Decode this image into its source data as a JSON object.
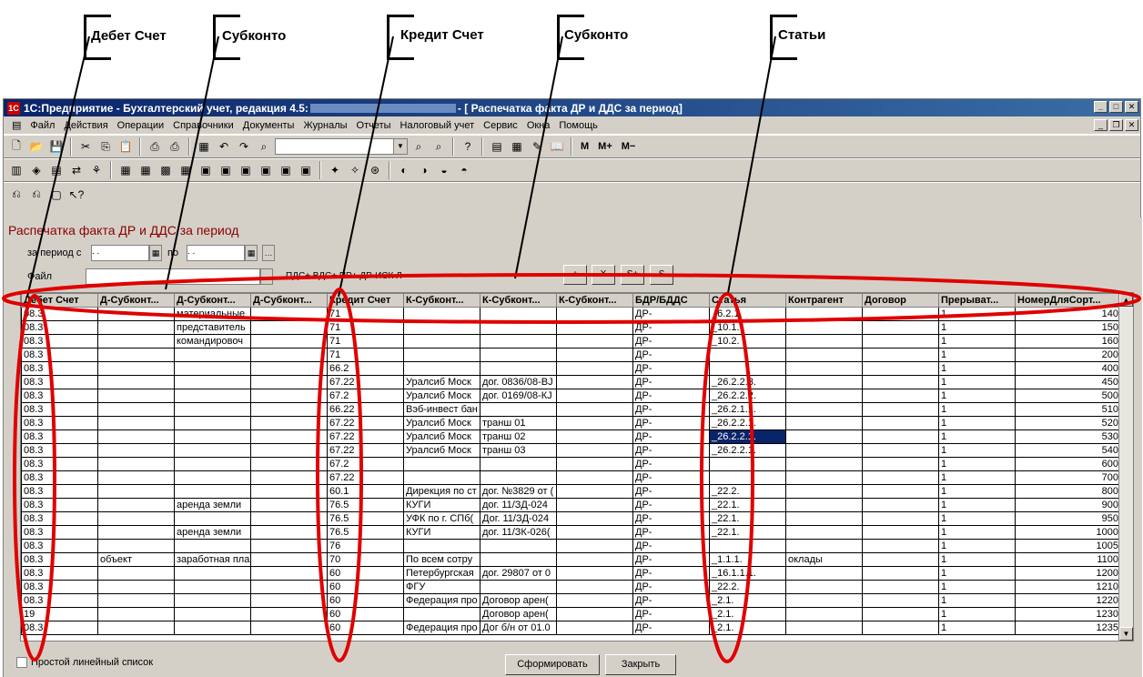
{
  "annotations": [
    "Дебет Счет",
    "Субконто",
    "Кредит Счет",
    "Субконто",
    "Статьи"
  ],
  "window": {
    "title": "1С:Предприятие - Бухгалтерский учет, редакция 4.5: ",
    "doc_title": " - [ Распечатка факта ДР и ДДС за период]"
  },
  "menu": [
    "Файл",
    "Действия",
    "Операции",
    "Справочники",
    "Документы",
    "Журналы",
    "Отчеты",
    "Налоговый учет",
    "Сервис",
    "Окна",
    "Помощь"
  ],
  "toolbar": {
    "m": "M",
    "mplus": "M+",
    "mminus": "M−"
  },
  "form": {
    "title": "Распечатка факта ДР и ДДС за период",
    "period_label": "за период с",
    "period_to_label": "по",
    "period_from": " .  .",
    "period_to": " .  .",
    "file_label": "Файл",
    "file_hint": "ПДС+ ВДС+ ПР+ ДР-ИСК Л",
    "btn_plus": "+",
    "btn_x": "X",
    "btn_splus": "S+",
    "btn_s": "S"
  },
  "table": {
    "columns": [
      "Дебет Счет",
      "Д-Субконт...",
      "Д-Субконт...",
      "Д-Субконт...",
      "Кредит Счет",
      "К-Субконт...",
      "К-Субконт...",
      "К-Субконт...",
      "БДР/БДДС",
      "Статья",
      "Контрагент",
      "Договор",
      "Прерыват...",
      "НомерДляСорт..."
    ],
    "rows": [
      [
        "08.3",
        "",
        "материальные",
        "",
        "71",
        "",
        "",
        "",
        "ДР-",
        "_6.2.1.",
        "",
        "",
        "1",
        "140"
      ],
      [
        "08.3",
        "",
        "представитель",
        "",
        "71",
        "",
        "",
        "",
        "ДР-",
        "_10.1.",
        "",
        "",
        "1",
        "150"
      ],
      [
        "08.3",
        "",
        "командировоч",
        "",
        "71",
        "",
        "",
        "",
        "ДР-",
        "_10.2.",
        "",
        "",
        "1",
        "160"
      ],
      [
        "08.3",
        "",
        "",
        "",
        "71",
        "",
        "",
        "",
        "ДР-",
        "",
        "",
        "",
        "1",
        "200"
      ],
      [
        "08.3",
        "",
        "",
        "",
        "66.2",
        "",
        "",
        "",
        "ДР-",
        "",
        "",
        "",
        "1",
        "400"
      ],
      [
        "08.3",
        "",
        "",
        "",
        "67.22",
        "Уралсиб Моск",
        "дог. 0836/08-ВЈ",
        "",
        "ДР-",
        "_26.2.2.3.",
        "",
        "",
        "1",
        "450"
      ],
      [
        "08.3",
        "",
        "",
        "",
        "67.2",
        "Уралсиб Моск",
        "дог. 0169/08-КЈ",
        "",
        "ДР-",
        "_26.2.2.2.",
        "",
        "",
        "1",
        "500"
      ],
      [
        "08.3",
        "",
        "",
        "",
        "66.22",
        "Вэб-инвест бан",
        "",
        "",
        "ДР-",
        "_26.2.1.1.",
        "",
        "",
        "1",
        "510"
      ],
      [
        "08.3",
        "",
        "",
        "",
        "67.22",
        "Уралсиб Моск",
        "транш 01",
        "",
        "ДР-",
        "_26.2.2.1.",
        "",
        "",
        "1",
        "520"
      ],
      [
        "08.3",
        "",
        "",
        "",
        "67.22",
        "Уралсиб Моск",
        "транш 02",
        "",
        "ДР-",
        "_26.2.2.1.",
        "",
        "",
        "1",
        "530"
      ],
      [
        "08.3",
        "",
        "",
        "",
        "67.22",
        "Уралсиб Моск",
        "транш 03",
        "",
        "ДР-",
        "_26.2.2.1.",
        "",
        "",
        "1",
        "540"
      ],
      [
        "08.3",
        "",
        "",
        "",
        "67.2",
        "",
        "",
        "",
        "ДР-",
        "",
        "",
        "",
        "1",
        "600"
      ],
      [
        "08.3",
        "",
        "",
        "",
        "67.22",
        "",
        "",
        "",
        "ДР-",
        "",
        "",
        "",
        "1",
        "700"
      ],
      [
        "08.3",
        "",
        "",
        "",
        "60.1",
        "Дирекция по ст",
        "дог. №3829 от (",
        "",
        "ДР-",
        "_22.2.",
        "",
        "",
        "1",
        "800"
      ],
      [
        "08.3",
        "",
        "аренда земли",
        "",
        "76.5",
        "КУГИ",
        "дог. 11/ЗД-024",
        "",
        "ДР-",
        "_22.1.",
        "",
        "",
        "1",
        "900"
      ],
      [
        "08.3",
        "",
        "",
        "",
        "76.5",
        "УФК по г. СПб(",
        "Дог. 11/ЗД-024",
        "",
        "ДР-",
        "_22.1.",
        "",
        "",
        "1",
        "950"
      ],
      [
        "08.3",
        "",
        "аренда земли",
        "",
        "76.5",
        "КУГИ",
        "дог. 11/ЗК-026(",
        "",
        "ДР-",
        "_22.1.",
        "",
        "",
        "1",
        "1000"
      ],
      [
        "08.3",
        "",
        "",
        "",
        "76",
        "",
        "",
        "",
        "ДР-",
        "",
        "",
        "",
        "1",
        "1005"
      ],
      [
        "08.3",
        "объект",
        "заработная пла",
        "",
        "70",
        "По всем сотру",
        "",
        "",
        "ДР-",
        "_1.1.1.",
        "оклады",
        "",
        "1",
        "1100"
      ],
      [
        "08.3",
        "",
        "",
        "",
        "60",
        "Петербургская",
        "дог. 29807 от 0",
        "",
        "ДР-",
        "_16.1.1.1.",
        "",
        "",
        "1",
        "1200"
      ],
      [
        "08.3",
        "",
        "",
        "",
        "60",
        "ФГУ",
        "",
        "",
        "ДР-",
        "_22.2.",
        "",
        "",
        "1",
        "1210"
      ],
      [
        "08.3",
        "",
        "",
        "",
        "60",
        "Федерация про",
        "Договор арен(",
        "",
        "ДР-",
        "_2.1.",
        "",
        "",
        "1",
        "1220"
      ],
      [
        "19",
        "",
        "",
        "",
        "60",
        "",
        "Договор арен(",
        "",
        "ДР-",
        "_2.1.",
        "",
        "",
        "1",
        "1230"
      ],
      [
        "08.3",
        "",
        "",
        "",
        "60",
        "Федерация про",
        "Дог б/н от 01.0",
        "",
        "ДР-",
        "_2.1.",
        "",
        "",
        "1",
        "1235"
      ]
    ]
  },
  "footer": {
    "checkbox_label": "Простой линейный список",
    "generate": "Сформировать",
    "close": "Закрыть"
  }
}
